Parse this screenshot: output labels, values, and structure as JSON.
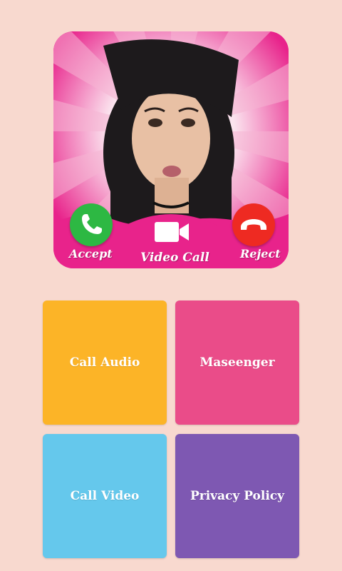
{
  "hero": {
    "accept_label": "Accept",
    "video_call_label": "Video Call",
    "reject_label": "Reject",
    "accept_icon": "phone-icon",
    "reject_icon": "hang-up-icon",
    "video_icon": "video-camera-icon"
  },
  "menu": {
    "call_audio": "Call Audio",
    "messenger": "Maseenger",
    "call_video": "Call Video",
    "privacy_policy": "Privacy Policy"
  },
  "colors": {
    "background": "#f8d9cf",
    "hero_pink": "#e8238b",
    "accept_green": "#2db843",
    "reject_red": "#ee2a22",
    "tile_call_audio": "#fcb427",
    "tile_messenger": "#ea4c89",
    "tile_call_video": "#65c8ec",
    "tile_privacy_policy": "#7e58b2"
  }
}
